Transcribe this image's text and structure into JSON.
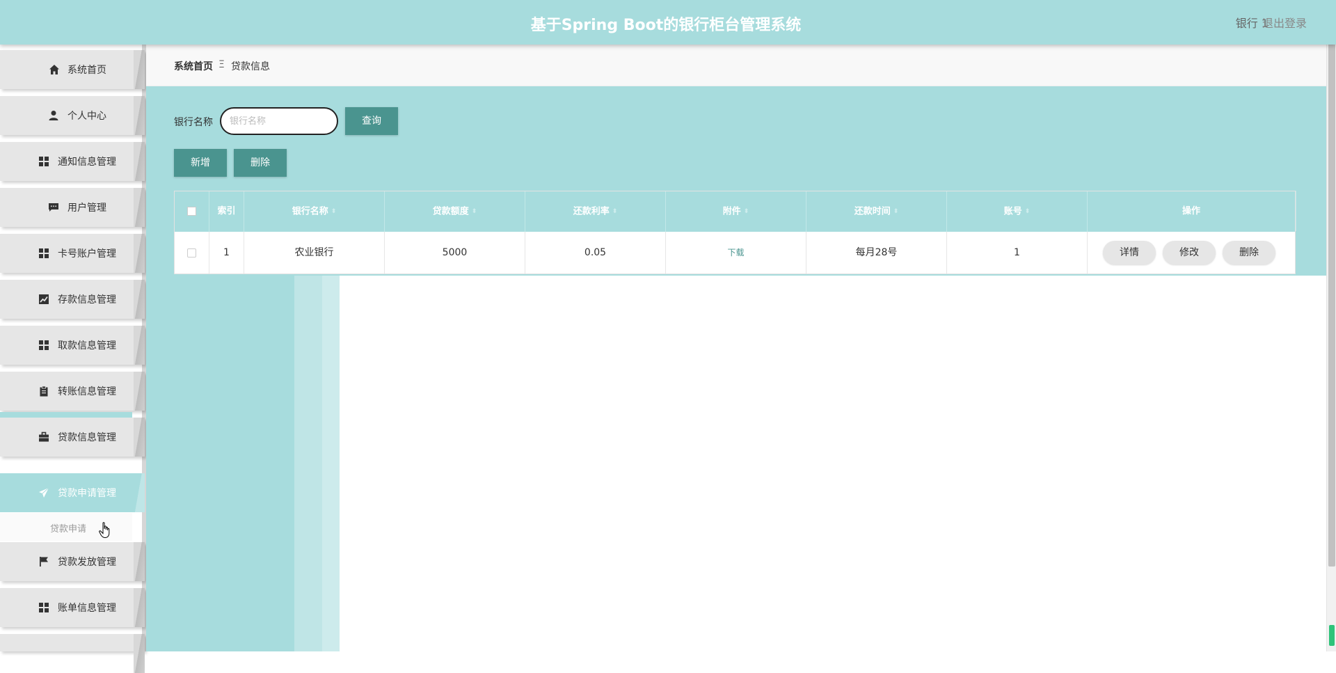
{
  "app": {
    "title": "基于Spring Boot的银行柜台管理系统",
    "user": "银行 1",
    "logout": "退出登录",
    "accent": "#a7dcdd",
    "button_color": "#4a948f"
  },
  "sidebar": {
    "items": [
      {
        "label": "系统首页",
        "icon": "home-icon"
      },
      {
        "label": "个人中心",
        "icon": "user-icon"
      },
      {
        "label": "通知信息管理",
        "icon": "grid-icon"
      },
      {
        "label": "用户管理",
        "icon": "chat-icon"
      },
      {
        "label": "卡号账户管理",
        "icon": "grid-icon"
      },
      {
        "label": "存款信息管理",
        "icon": "chart-icon"
      },
      {
        "label": "取款信息管理",
        "icon": "grid-icon"
      },
      {
        "label": "转账信息管理",
        "icon": "clipboard-icon"
      },
      {
        "label": "贷款信息管理",
        "icon": "briefcase-icon"
      },
      {
        "label": "贷款申请管理",
        "icon": "send-icon",
        "active": true
      },
      {
        "label": "贷款发放管理",
        "icon": "flag-icon"
      },
      {
        "label": "账单信息管理",
        "icon": "grid-icon"
      }
    ],
    "submenu": {
      "label": "贷款申请"
    }
  },
  "breadcrumb": {
    "home": "系统首页",
    "separator": "Ξ",
    "current": "贷款信息"
  },
  "search": {
    "label": "银行名称",
    "placeholder": "银行名称",
    "value": "",
    "query_button": "查询"
  },
  "actions": {
    "add": "新增",
    "delete": "删除"
  },
  "table": {
    "columns": [
      "索引",
      "银行名称",
      "贷款额度",
      "还款利率",
      "附件",
      "还款时间",
      "账号",
      "操作"
    ],
    "rows": [
      {
        "index": "1",
        "bank_name": "农业银行",
        "loan_amount": "5000",
        "interest_rate": "0.05",
        "attachment": "下载",
        "repay_time": "每月28号",
        "account": "1",
        "ops": [
          "详情",
          "修改",
          "删除"
        ]
      }
    ]
  }
}
